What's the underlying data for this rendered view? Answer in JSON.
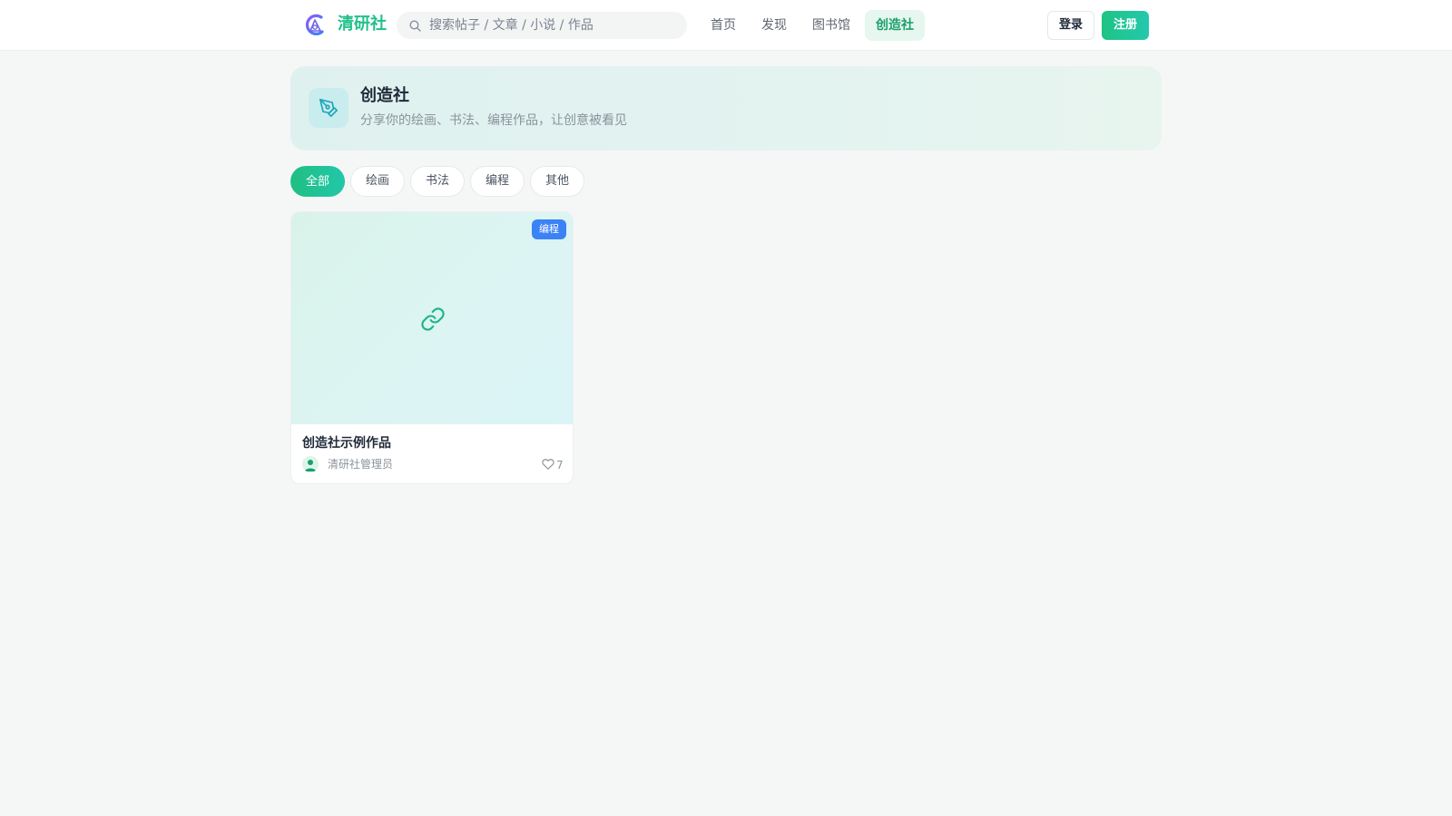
{
  "header": {
    "logo_icon": "brand-logo-icon",
    "logo_text": "清研社",
    "search": {
      "placeholder": "搜索帖子 / 文章 / 小说 / 作品",
      "value": ""
    },
    "nav": [
      {
        "label": "首页",
        "active": false
      },
      {
        "label": "发现",
        "active": false
      },
      {
        "label": "图书馆",
        "active": false
      },
      {
        "label": "创造社",
        "active": true
      }
    ],
    "login_label": "登录",
    "register_label": "注册"
  },
  "hero": {
    "icon": "pen-tool-icon",
    "title": "创造社",
    "subtitle": "分享你的绘画、书法、编程作品，让创意被看见"
  },
  "filters": [
    {
      "label": "全部",
      "active": true
    },
    {
      "label": "绘画",
      "active": false
    },
    {
      "label": "书法",
      "active": false
    },
    {
      "label": "编程",
      "active": false
    },
    {
      "label": "其他",
      "active": false
    }
  ],
  "works": [
    {
      "cover_icon": "link-icon",
      "tag": "编程",
      "title": "创造社示例作品",
      "author": "清研社管理员",
      "likes": "7"
    }
  ],
  "colors": {
    "accent": "#22c08a",
    "accent_gradient_end": "#23c9ad",
    "tag_blue": "#3b82f6",
    "page_bg": "#f5f7f6"
  }
}
